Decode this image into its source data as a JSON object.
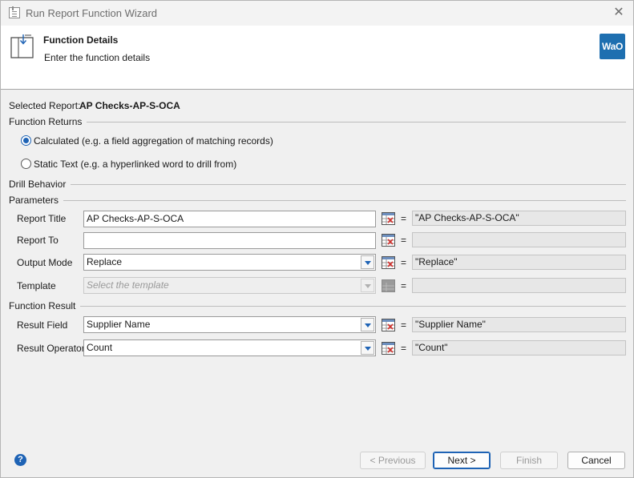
{
  "window": {
    "title": "Run Report Function Wizard",
    "close_glyph": "✕"
  },
  "header": {
    "title": "Function Details",
    "subtitle": "Enter the function details",
    "logo_text": "WaO",
    "icon": "wizard-page-icon"
  },
  "selected_report": {
    "label": "Selected Report:",
    "value": "AP Checks-AP-S-OCA"
  },
  "function_returns": {
    "group_label": "Function Returns",
    "options": [
      {
        "label": "Calculated (e.g. a field aggregation of matching records)",
        "selected": true
      },
      {
        "label": "Static Text (e.g. a hyperlinked word to drill from)",
        "selected": false
      }
    ]
  },
  "drill_behavior": {
    "group_label": "Drill Behavior"
  },
  "parameters": {
    "group_label": "Parameters",
    "rows": [
      {
        "label": "Report Title",
        "value": "AP Checks-AP-S-OCA",
        "result": "\"AP Checks-AP-S-OCA\""
      },
      {
        "label": "Report To",
        "value": "",
        "result": ""
      },
      {
        "label": "Output Mode",
        "value": "Replace",
        "result": "\"Replace\""
      },
      {
        "label": "Template",
        "placeholder": "Select the template",
        "result": ""
      }
    ]
  },
  "function_result": {
    "group_label": "Function Result",
    "rows": [
      {
        "label": "Result Field",
        "value": "Supplier Name",
        "result": "\"Supplier Name\""
      },
      {
        "label": "Result Operator",
        "value": "Count",
        "result": "\"Count\""
      }
    ]
  },
  "equals_sign": "=",
  "footer": {
    "help_glyph": "?",
    "previous": "< Previous",
    "next": "Next >",
    "finish": "Finish",
    "cancel": "Cancel"
  },
  "colors": {
    "accent": "#1e63b5",
    "logo_bg": "#1e6fb0"
  }
}
